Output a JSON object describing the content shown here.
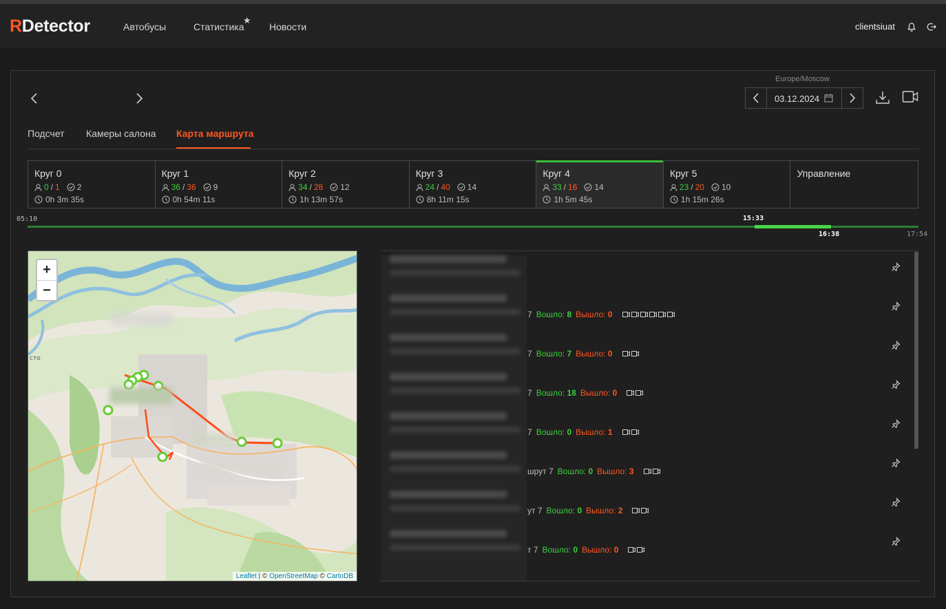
{
  "app": {
    "logo_r": "R",
    "logo_rest": "Detector"
  },
  "nav": {
    "buses": "Автобусы",
    "stats": "Статистика",
    "news": "Новости"
  },
  "user": {
    "name": "clientsiuat"
  },
  "date": {
    "timezone": "Europe/Moscow",
    "value": "03.12.2024"
  },
  "tabs": [
    {
      "label": "Подсчет"
    },
    {
      "label": "Камеры салона"
    },
    {
      "label": "Карта маршрута"
    }
  ],
  "rounds": [
    {
      "name": "Круг 0",
      "in": "0",
      "out": "1",
      "stops": "2",
      "time": "0h 3m 35s"
    },
    {
      "name": "Круг 1",
      "in": "36",
      "out": "36",
      "stops": "9",
      "time": "0h 54m 11s"
    },
    {
      "name": "Круг 2",
      "in": "34",
      "out": "28",
      "stops": "12",
      "time": "1h 13m 57s"
    },
    {
      "name": "Круг 3",
      "in": "24",
      "out": "40",
      "stops": "14",
      "time": "8h 11m 15s"
    },
    {
      "name": "Круг 4",
      "in": "33",
      "out": "16",
      "stops": "14",
      "time": "1h 5m 45s"
    },
    {
      "name": "Круг 5",
      "in": "23",
      "out": "20",
      "stops": "10",
      "time": "1h 15m 26s"
    }
  ],
  "manage_label": "Управление",
  "timeline": {
    "start": "05:10",
    "sel_start": "15:33",
    "sel_end": "16:38",
    "end": "17:54",
    "sel_from_fraction": 0.816,
    "sel_to_fraction": 0.902
  },
  "map": {
    "zoom_in": "+",
    "zoom_out": "−",
    "attr_leaflet": "Leaflet",
    "attr_sep1": " | © ",
    "attr_osm": "OpenStreetMap",
    "attr_sep2": " © ",
    "attr_carto": "CartoDB",
    "water_label": "сто"
  },
  "stops": [
    {
      "prefix": "",
      "in_label": "Вошло:",
      "in": "",
      "out_label": "Вышло:",
      "out": "",
      "cams": 0
    },
    {
      "prefix": "7",
      "in_label": "Вошло:",
      "in": "8",
      "out_label": "Вышло:",
      "out": "0",
      "cams": 6
    },
    {
      "prefix": "7",
      "in_label": "Вошло:",
      "in": "7",
      "out_label": "Вышло:",
      "out": "0",
      "cams": 2
    },
    {
      "prefix": "7",
      "in_label": "Вошло:",
      "in": "18",
      "out_label": "Вышло:",
      "out": "0",
      "cams": 2
    },
    {
      "prefix": "7",
      "in_label": "Вошло:",
      "in": "0",
      "out_label": "Вышло:",
      "out": "1",
      "cams": 2
    },
    {
      "prefix": "шрут 7",
      "in_label": "Вошло:",
      "in": "0",
      "out_label": "Вышло:",
      "out": "3",
      "cams": 2
    },
    {
      "prefix": "ут 7",
      "in_label": "Вошло:",
      "in": "0",
      "out_label": "Вышло:",
      "out": "2",
      "cams": 2
    },
    {
      "prefix": "т 7",
      "in_label": "Вошло:",
      "in": "0",
      "out_label": "Вышло:",
      "out": "0",
      "cams": 2
    }
  ],
  "colors": {
    "accent": "#ff5722",
    "in": "#3ecf3e",
    "out": "#ff5722",
    "selected_round": "#3bbf3b"
  }
}
